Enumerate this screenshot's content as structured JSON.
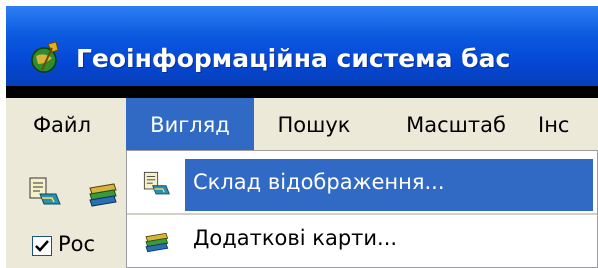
{
  "window": {
    "title": "Геоінформаційна система бас",
    "app_icon": "globe-pin-icon"
  },
  "menubar": {
    "items": [
      {
        "label": "Файл",
        "active": false
      },
      {
        "label": "Вигляд",
        "active": true
      },
      {
        "label": "Пошук",
        "active": false
      },
      {
        "label": "Масштаб",
        "active": false
      },
      {
        "label": "Інс",
        "active": false
      }
    ]
  },
  "toolbar": {
    "buttons": [
      {
        "icon": "layers-composition-icon"
      },
      {
        "icon": "additional-maps-icon"
      }
    ]
  },
  "left_pane": {
    "checkbox_checked": true,
    "label": "Рос"
  },
  "view_menu": {
    "items": [
      {
        "label": "Склад відображення...",
        "icon": "layers-composition-icon",
        "highlighted": true
      },
      {
        "label": "Додаткові карти...",
        "icon": "additional-maps-icon",
        "highlighted": false
      }
    ]
  },
  "colors": {
    "titlebar": "#0447d6",
    "menu_highlight": "#316ac5",
    "chrome": "#ece9d8"
  }
}
